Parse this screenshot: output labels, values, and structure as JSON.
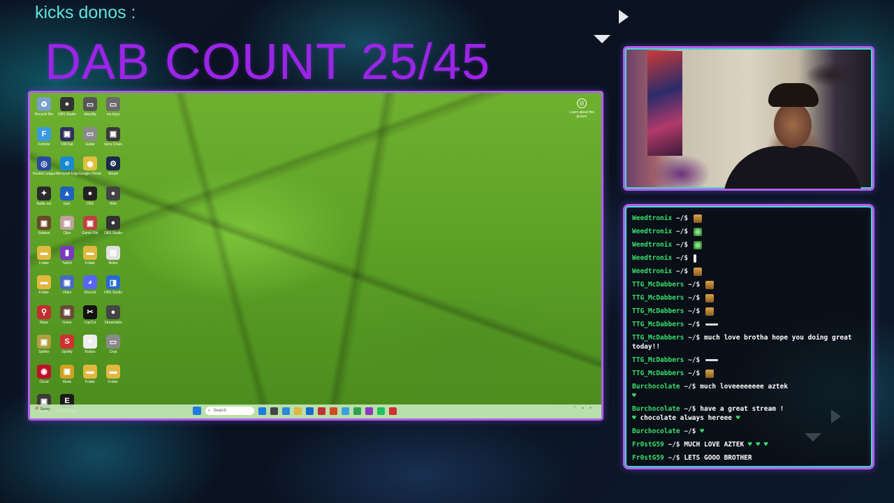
{
  "overlay": {
    "kicks_label": "kicks donos :",
    "dab_count": "DAB COUNT 25/45"
  },
  "desktop": {
    "icons": [
      {
        "label": "Recycle Bin",
        "icon": "recycle-bin-icon",
        "color": "#7aa0c8",
        "glyph": "♻"
      },
      {
        "label": "OBS Studio",
        "icon": "obs-icon",
        "color": "#333333",
        "glyph": "●"
      },
      {
        "label": "Alacritty",
        "icon": "app-icon",
        "color": "#555555",
        "glyph": "▭"
      },
      {
        "label": "my-keys",
        "icon": "app-icon",
        "color": "#6a6a6a",
        "glyph": "▭"
      },
      {
        "label": "Fortnite",
        "icon": "fortnite-icon",
        "color": "#3a9ae0",
        "glyph": "F"
      },
      {
        "label": "VRChat",
        "icon": "app-icon",
        "color": "#303060",
        "glyph": "▣"
      },
      {
        "label": "Guitar",
        "icon": "app-icon",
        "color": "#8a8a8a",
        "glyph": "▭"
      },
      {
        "label": "Sims Chars",
        "icon": "app-icon",
        "color": "#3a3a3a",
        "glyph": "▣"
      },
      {
        "label": "Rocket League",
        "icon": "rocket-league-icon",
        "color": "#2a4aa0",
        "glyph": "◎"
      },
      {
        "label": "Microsoft Edge",
        "icon": "edge-icon",
        "color": "#1a8ad0",
        "glyph": "e"
      },
      {
        "label": "Google Chrome",
        "icon": "chrome-icon",
        "color": "#e0c040",
        "glyph": "◉"
      },
      {
        "label": "Steam",
        "icon": "steam-icon",
        "color": "#1a2a4a",
        "glyph": "⚙"
      },
      {
        "label": "Battle.net",
        "icon": "app-icon",
        "color": "#2a2a2a",
        "glyph": "✦"
      },
      {
        "label": "Epic",
        "icon": "app-icon",
        "color": "#2060c0",
        "glyph": "▲"
      },
      {
        "label": "OBS",
        "icon": "obs-icon",
        "color": "#222222",
        "glyph": "●"
      },
      {
        "label": "Web",
        "icon": "app-icon",
        "color": "#444444",
        "glyph": "●"
      },
      {
        "label": "Sidebar",
        "icon": "app-icon",
        "color": "#6a4a2a",
        "glyph": "▣"
      },
      {
        "label": "Clips",
        "icon": "app-icon",
        "color": "#c0a0a0",
        "glyph": "▣"
      },
      {
        "label": "Game File",
        "icon": "app-icon",
        "color": "#c04040",
        "glyph": "▣"
      },
      {
        "label": "OBS Studio",
        "icon": "obs-icon",
        "color": "#333333",
        "glyph": "●"
      },
      {
        "label": "Folder",
        "icon": "folder-icon",
        "color": "#e0b840",
        "glyph": "▬"
      },
      {
        "label": "Twitch",
        "icon": "twitch-icon",
        "color": "#7a3ac0",
        "glyph": "▮"
      },
      {
        "label": "Folder",
        "icon": "folder-icon",
        "color": "#e0b840",
        "glyph": "▬"
      },
      {
        "label": "Notes",
        "icon": "file-icon",
        "color": "#e0e0e0",
        "glyph": "▤"
      },
      {
        "label": "Folder",
        "icon": "folder-icon",
        "color": "#e0b840",
        "glyph": "▬"
      },
      {
        "label": "Video",
        "icon": "app-icon",
        "color": "#4a6ac0",
        "glyph": "▣"
      },
      {
        "label": "Discord",
        "icon": "discord-icon",
        "color": "#5865f2",
        "glyph": "◕"
      },
      {
        "label": "OBS Studio",
        "icon": "obs-icon",
        "color": "#2a6ad0",
        "glyph": "◨"
      },
      {
        "label": "Maps",
        "icon": "maps-icon",
        "color": "#c03030",
        "glyph": "⚲"
      },
      {
        "label": "Game",
        "icon": "app-icon",
        "color": "#6a4a3a",
        "glyph": "▣"
      },
      {
        "label": "CapCut",
        "icon": "capcut-icon",
        "color": "#111111",
        "glyph": "✂"
      },
      {
        "label": "Streamlabs",
        "icon": "app-icon",
        "color": "#444444",
        "glyph": "●"
      },
      {
        "label": "Splitter",
        "icon": "app-icon",
        "color": "#b0a040",
        "glyph": "▣"
      },
      {
        "label": "Spotify",
        "icon": "app-icon",
        "color": "#d03030",
        "glyph": "S"
      },
      {
        "label": "Roblox",
        "icon": "app-icon",
        "color": "#eeeeee",
        "glyph": "●"
      },
      {
        "label": "Chat",
        "icon": "app-icon",
        "color": "#8a8a8a",
        "glyph": "▭"
      },
      {
        "label": "Cloud",
        "icon": "app-icon",
        "color": "#c0102a",
        "glyph": "◉"
      },
      {
        "label": "Mask",
        "icon": "app-icon",
        "color": "#d0a020",
        "glyph": "▣"
      },
      {
        "label": "Folder",
        "icon": "folder-icon",
        "color": "#e0b840",
        "glyph": "▬"
      },
      {
        "label": "Folder",
        "icon": "folder-icon",
        "color": "#e0b840",
        "glyph": "▬"
      },
      {
        "label": "Game",
        "icon": "app-icon",
        "color": "#3a3a3a",
        "glyph": "▣"
      },
      {
        "label": "Epic Games",
        "icon": "epic-games-icon",
        "color": "#1a1a1a",
        "glyph": "E"
      }
    ],
    "learn_label": "Learn about this picture",
    "taskbar": {
      "weather": "Sunny",
      "search_placeholder": "Search",
      "clock_time": "",
      "clock_date": "",
      "apps": [
        "#1f7ae0",
        "#444444",
        "#2a8ae0",
        "#e0b840",
        "#1a6ad0",
        "#c03030",
        "#d04a20",
        "#3aa0e0",
        "#30a050",
        "#8a3ac0",
        "#20c060",
        "#d03030"
      ]
    }
  },
  "chat": {
    "messages": [
      {
        "user": "Weedtronix",
        "prompt": "~/$",
        "text": "",
        "emotes": [
          "cup"
        ]
      },
      {
        "user": "Weedtronix",
        "prompt": "~/$",
        "text": "",
        "emotes": [
          "weed"
        ]
      },
      {
        "user": "Weedtronix",
        "prompt": "~/$",
        "text": "",
        "emotes": [
          "weed"
        ]
      },
      {
        "user": "Weedtronix",
        "prompt": "~/$",
        "text": "",
        "emotes": [
          "bar-v"
        ]
      },
      {
        "user": "Weedtronix",
        "prompt": "~/$",
        "text": "",
        "emotes": [
          "cup"
        ]
      },
      {
        "user": "TTG_McDabbers",
        "prompt": "~/$",
        "text": "",
        "emotes": [
          "cup"
        ]
      },
      {
        "user": "TTG_McDabbers",
        "prompt": "~/$",
        "text": "",
        "emotes": [
          "cup"
        ]
      },
      {
        "user": "TTG_McDabbers",
        "prompt": "~/$",
        "text": "",
        "emotes": [
          "cup"
        ]
      },
      {
        "user": "TTG_McDabbers",
        "prompt": "~/$",
        "text": "",
        "emotes": [
          "bar"
        ]
      },
      {
        "user": "TTG_McDabbers",
        "prompt": "~/$",
        "text": "much love brotha hope you doing great today!!",
        "emotes": []
      },
      {
        "user": "TTG_McDabbers",
        "prompt": "~/$",
        "text": "",
        "emotes": [
          "bar"
        ]
      },
      {
        "user": "TTG_McDabbers",
        "prompt": "~/$",
        "text": "",
        "emotes": [
          "cup"
        ]
      },
      {
        "user": "Burchocolate",
        "prompt": "~/$",
        "text": "much loveeeeeeee aztek",
        "emotes": [
          "heart-newline"
        ]
      },
      {
        "user": "Burchocolate",
        "prompt": "~/$",
        "text": "have a great stream !",
        "emotes": [
          "heart-line2"
        ]
      },
      {
        "user": "Burchocolate",
        "prompt": "~/$",
        "text": "",
        "emotes": [
          "heart"
        ]
      },
      {
        "user": "Fr0stG59",
        "prompt": "~/$",
        "text": "MUCH LOVE AZTEK",
        "emotes": [
          "heart",
          "heart",
          "heart"
        ]
      },
      {
        "user": "Fr0stG59",
        "prompt": "~/$",
        "text": "LETS GOOO BROTHER",
        "emotes": []
      }
    ],
    "line2_text": "chocolate always hereee"
  },
  "colors": {
    "accent_purple": "#9b25e6",
    "accent_cyan": "#43d6d0",
    "chat_user": "#39e06a"
  }
}
